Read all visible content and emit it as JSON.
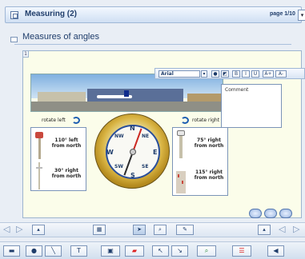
{
  "window": {
    "title": "Measuring (2)",
    "page_indicator": "page 1/10",
    "page_dropdown_icon": "chevron-down-icon"
  },
  "section": {
    "title": "Measures of angles"
  },
  "panel": {
    "number": "1"
  },
  "format_toolbar": {
    "font": "Arial",
    "bold": "B",
    "italic": "I",
    "underline": "U",
    "grow": "A+",
    "shrink": "A-"
  },
  "comment": {
    "label": "Comment"
  },
  "rotate": {
    "left": "rotate left",
    "right": "rotate right"
  },
  "cards": {
    "left_top": "110° left\nfrom north",
    "left_bottom": "30° right\nfrom north",
    "right_top": "75° right\nfrom north",
    "right_bottom": "115° right\nfrom north"
  },
  "compass": {
    "n": "N",
    "e": "E",
    "s": "S",
    "w": "W",
    "ne": "NE",
    "nw": "NW",
    "se": "SE",
    "sw": "SW"
  },
  "colors": {
    "accent": "#1f3d6b",
    "panel_bg": "#fbfdea",
    "window_bg": "#e9eef5"
  }
}
